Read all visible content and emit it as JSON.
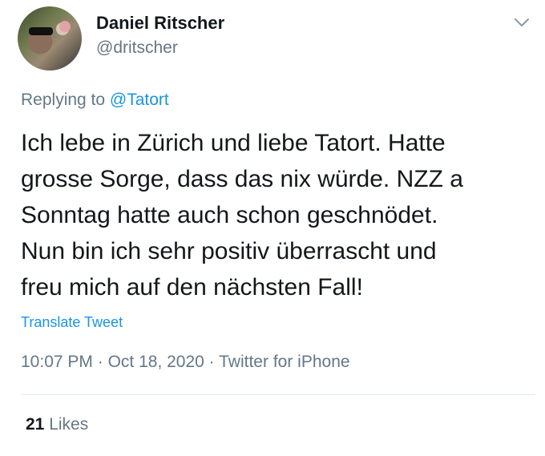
{
  "tweet": {
    "author": {
      "name": "Daniel Ritscher",
      "handle": "@dritscher"
    },
    "replying_prefix": "Replying to ",
    "replying_to": "@Tatort",
    "text": "Ich lebe in Zürich und liebe Tatort. Hatte\ngrosse Sorge, dass das nix würde. NZZ a\nSonntag hatte auch schon geschnödet.\nNun bin ich sehr positiv überrascht und\nfreu mich auf den nächsten Fall!",
    "translate_label": "Translate Tweet",
    "time": "10:07 PM",
    "separator": "·",
    "date": "Oct 18, 2020",
    "source": "Twitter for iPhone",
    "likes_count": "21",
    "likes_label": "Likes"
  },
  "icons": {
    "menu": "chevron-down-icon"
  },
  "colors": {
    "text": "#14171a",
    "muted": "#657786",
    "link": "#1b95e0",
    "divider": "#e1e8ed"
  }
}
